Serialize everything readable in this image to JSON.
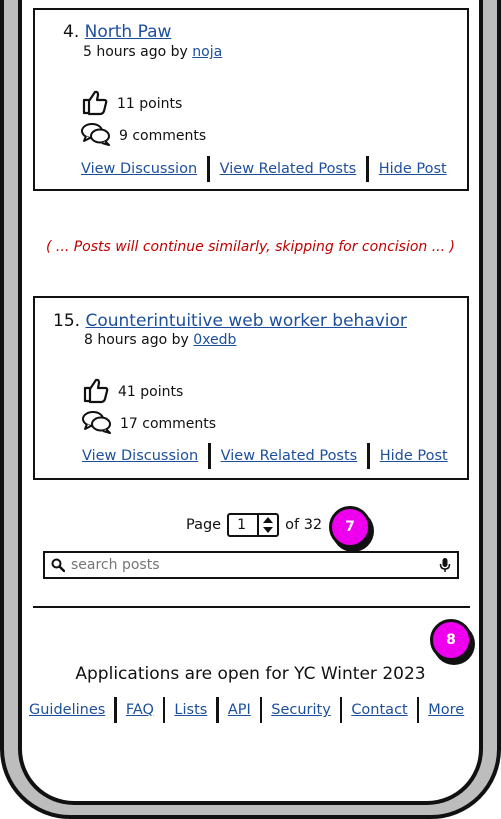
{
  "posts": [
    {
      "number": "4.",
      "title": "North Paw",
      "age": "5 hours ago by",
      "author": "noja",
      "points": "11 points",
      "comments": "9 comments",
      "actions": [
        "View Discussion",
        "View Related Posts",
        "Hide Post"
      ]
    },
    {
      "number": "15.",
      "title": "Counterintuitive web worker behavior",
      "age": "8 hours ago by",
      "author": "0xedb",
      "points": "41 points",
      "comments": "17 comments",
      "actions": [
        "View Discussion",
        "View Related Posts",
        "Hide Post"
      ]
    }
  ],
  "note": "( ... Posts will continue similarly, skipping for concision ... )",
  "pager": {
    "label": "Page",
    "value": "1",
    "of": "of 32"
  },
  "badges": {
    "pager": "7",
    "footer": "8"
  },
  "search": {
    "placeholder": "search posts"
  },
  "yc_banner": "Applications are open for YC Winter 2023",
  "footer_links": [
    "Guidelines",
    "FAQ",
    "Lists",
    "API",
    "Security",
    "Contact",
    "More"
  ],
  "colors": {
    "link": "#1d4f9c",
    "note": "#c00000",
    "badge": "#ee00ee"
  },
  "icons": [
    "thumbs-up-icon",
    "comments-icon",
    "search-icon",
    "microphone-icon",
    "spinner-arrows-icon"
  ]
}
